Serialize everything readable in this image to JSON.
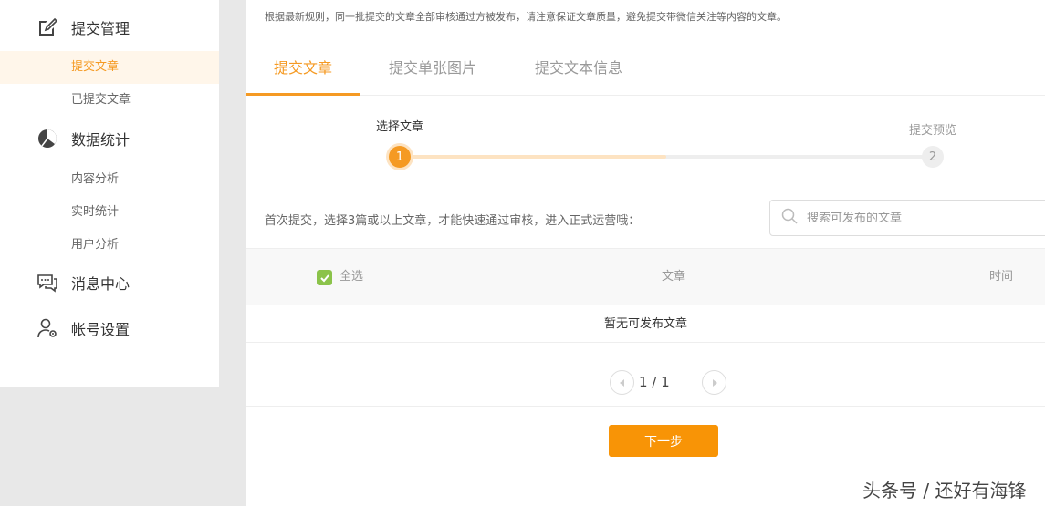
{
  "sidebar": {
    "groups": [
      {
        "label": "提交管理",
        "icon": "submit-edit-icon"
      },
      {
        "label": "数据统计",
        "icon": "pie-chart-icon"
      },
      {
        "label": "消息中心",
        "icon": "message-icon"
      },
      {
        "label": "帐号设置",
        "icon": "user-settings-icon"
      }
    ],
    "submit_items": [
      "提交文章",
      "已提交文章"
    ],
    "stats_items": [
      "内容分析",
      "实时统计",
      "用户分析"
    ],
    "active_item": "提交文章"
  },
  "main": {
    "notice": "根据最新规则，同一批提交的文章全部审核通过方被发布，请注意保证文章质量，避免提交带微信关注等内容的文章。",
    "tabs": [
      "提交文章",
      "提交单张图片",
      "提交文本信息"
    ],
    "active_tab": "提交文章",
    "steps": [
      {
        "number": "1",
        "label": "选择文章"
      },
      {
        "number": "2",
        "label": "提交预览"
      }
    ],
    "current_step": 1,
    "hint": "首次提交，选择3篇或以上文章，才能快速通过审核，进入正式运营哦：",
    "search": {
      "placeholder": "搜索可发布的文章"
    },
    "table": {
      "select_all": "全选",
      "columns": [
        "文章",
        "时间"
      ],
      "empty": "暂无可发布文章"
    },
    "pagination": {
      "text": "1 / 1"
    },
    "next_button": "下一步"
  },
  "watermark": "头条号 / 还好有海锋",
  "colors": {
    "accent": "#f59a23",
    "checkbox": "#8bc34a",
    "button": "#f89406"
  }
}
